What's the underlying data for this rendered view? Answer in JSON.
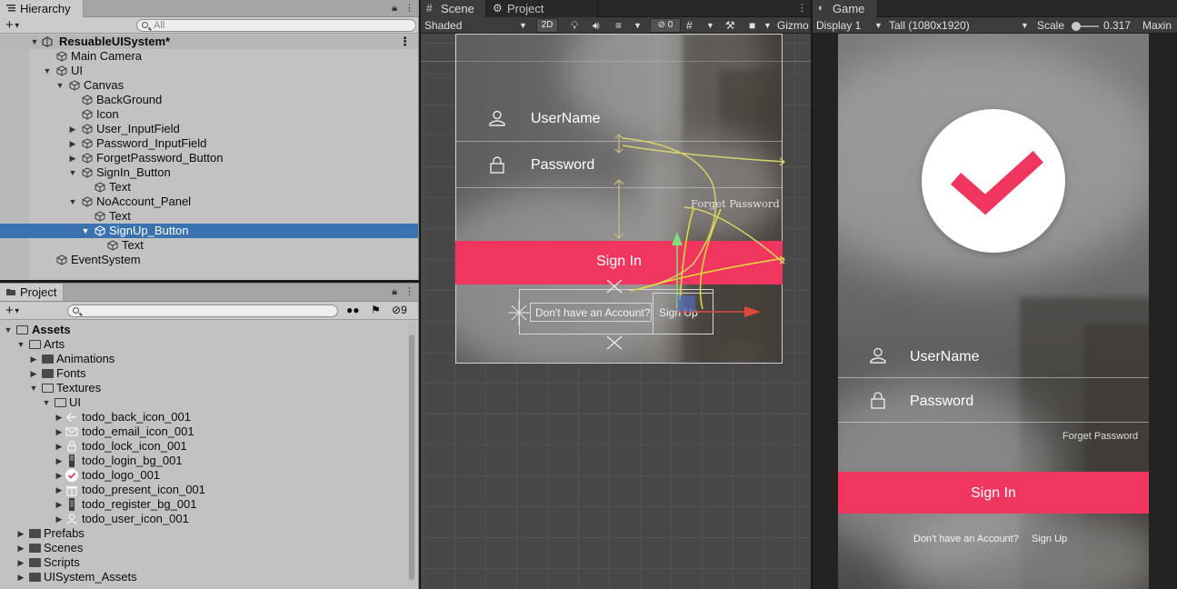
{
  "hierarchy": {
    "tab_label": "Hierarchy",
    "add_label": "+",
    "search_placeholder": "All",
    "scene_name": "ResuableUISystem*",
    "items": [
      {
        "label": "Main Camera"
      },
      {
        "label": "UI"
      },
      {
        "label": "Canvas"
      },
      {
        "label": "BackGround"
      },
      {
        "label": "Icon"
      },
      {
        "label": "User_InputField"
      },
      {
        "label": "Password_InputField"
      },
      {
        "label": "ForgetPassword_Button"
      },
      {
        "label": "SignIn_Button"
      },
      {
        "label": "Text"
      },
      {
        "label": "NoAccount_Panel"
      },
      {
        "label": "Text"
      },
      {
        "label": "SignUp_Button"
      },
      {
        "label": "Text"
      },
      {
        "label": "EventSystem"
      }
    ]
  },
  "project": {
    "tab_label": "Project",
    "add_label": "+",
    "hidden_count": "9",
    "items": [
      {
        "label": "Assets"
      },
      {
        "label": "Arts"
      },
      {
        "label": "Animations"
      },
      {
        "label": "Fonts"
      },
      {
        "label": "Textures"
      },
      {
        "label": "UI"
      },
      {
        "label": "todo_back_icon_001"
      },
      {
        "label": "todo_email_icon_001"
      },
      {
        "label": "todo_lock_icon_001"
      },
      {
        "label": "todo_login_bg_001"
      },
      {
        "label": "todo_logo_001"
      },
      {
        "label": "todo_present_icon_001"
      },
      {
        "label": "todo_register_bg_001"
      },
      {
        "label": "todo_user_icon_001"
      },
      {
        "label": "Prefabs"
      },
      {
        "label": "Scenes"
      },
      {
        "label": "Scripts"
      },
      {
        "label": "UISystem_Assets"
      }
    ]
  },
  "scene": {
    "tab_label": "Scene",
    "settings_tab_label": "Project Settings",
    "shading_mode": "Shaded",
    "mode_2d_label": "2D",
    "hidden_count": "0",
    "gizmos_label": "Gizmo",
    "username_label": "UserName",
    "password_label": "Password",
    "forget_label": "Forget Password",
    "signin_label": "Sign In",
    "noaccount_label": "Don't have an Account?",
    "signup_label": "Sign Up",
    "accent_color": "#f0365f"
  },
  "game": {
    "tab_label": "Game",
    "display_label": "Display 1",
    "resolution_label": "Tall (1080x1920)",
    "scale_label": "Scale",
    "scale_value": "0.317",
    "maximize_label": "Maxin",
    "username_label": "UserName",
    "password_label": "Password",
    "forget_label": "Forget Password",
    "signin_label": "Sign In",
    "noaccount_label": "Don't have an Account?",
    "signup_label": "Sign Up",
    "accent_color": "#f0365f"
  }
}
